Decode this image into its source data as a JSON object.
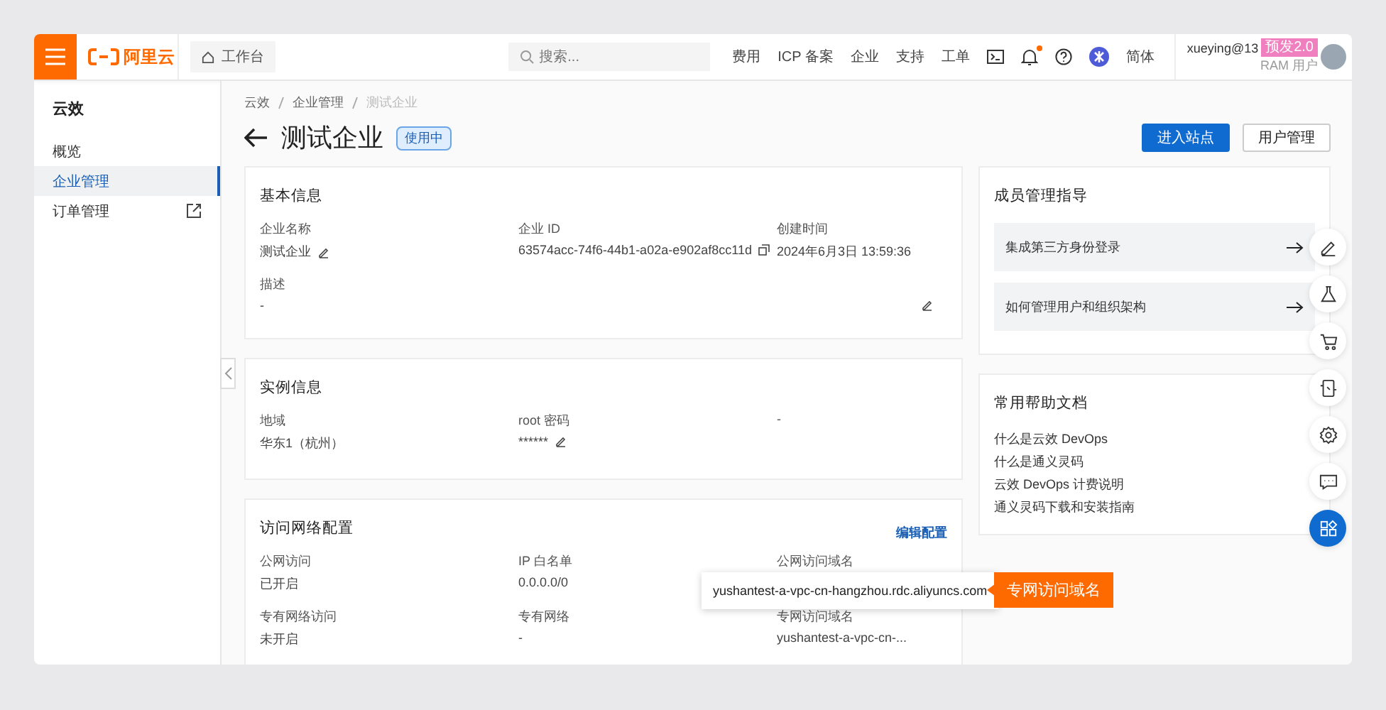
{
  "topbar": {
    "logo": "阿里云",
    "workbench": "工作台",
    "search": {
      "placeholder": "搜索..."
    },
    "nav": [
      "费用",
      "ICP 备案",
      "企业",
      "支持",
      "工单"
    ],
    "icons": [
      {
        "kind": "terminal",
        "dot": false
      },
      {
        "kind": "bell",
        "dot": true
      },
      {
        "kind": "help",
        "dot": false
      },
      {
        "kind": "app",
        "dot": false
      }
    ],
    "language": "简体",
    "user": {
      "name": "xueying@13",
      "role": "RAM 用户",
      "badge": "预发2.0"
    }
  },
  "sidebar": {
    "title": "云效",
    "items": [
      {
        "label": "概览",
        "selected": false,
        "external": false
      },
      {
        "label": "企业管理",
        "selected": true,
        "external": false
      },
      {
        "label": "订单管理",
        "selected": false,
        "external": true
      }
    ]
  },
  "breadcrumb": [
    "云效",
    "企业管理",
    "测试企业"
  ],
  "page": {
    "title": "测试企业",
    "status": "使用中",
    "buttons": [
      {
        "label": "进入站点",
        "kind": "primary"
      },
      {
        "label": "用户管理",
        "kind": "default"
      }
    ]
  },
  "cards": [
    {
      "title": "基本信息",
      "rows": [
        [
          {
            "label": "企业名称",
            "value": "测试企业",
            "editable": true,
            "copyable": false
          },
          {
            "label": "企业 ID",
            "value": "63574acc-74f6-44b1-a02a-e902af8cc11d",
            "editable": false,
            "copyable": true
          },
          {
            "label": "创建时间",
            "value": "2024年6月3日 13:59:36"
          }
        ],
        [
          {
            "label": "描述",
            "value": "-",
            "editable": true,
            "copyable": false
          }
        ]
      ]
    },
    {
      "title": "实例信息",
      "rows": [
        [
          {
            "label": "地域",
            "value": "华东1（杭州）"
          },
          {
            "label": "root 密码",
            "value": "******",
            "editable": true,
            "copyable": false
          },
          {
            "label": "-"
          }
        ]
      ]
    },
    {
      "title": "访问网络配置",
      "link": "编辑配置",
      "rows": [
        [
          {
            "label": "公网访问",
            "value": "已开启"
          },
          {
            "label": "IP 白名单",
            "value": "0.0.0.0/0"
          },
          {
            "label": "公网访问域名"
          }
        ],
        [
          {
            "label": "专有网络访问",
            "value": "未开启"
          },
          {
            "label": "专有网络",
            "value": "-"
          },
          {
            "label": "专网访问域名",
            "value": "yushantest-a-vpc-cn-..."
          }
        ]
      ],
      "tooltip": "yushantest-a-vpc-cn-hangzhou.rdc.aliyuncs.com",
      "callout": "专网访问域名"
    }
  ],
  "guide": {
    "title": "成员管理指导",
    "items": [
      "集成第三方身份登录",
      "如何管理用户和组织架构"
    ]
  },
  "docs": {
    "title": "常用帮助文档",
    "links": [
      "什么是云效 DevOps",
      "什么是通义灵码",
      "云效 DevOps 计费说明",
      "通义灵码下载和安装指南"
    ]
  },
  "float_buttons": [
    {
      "kind": "edit",
      "selected": false
    },
    {
      "kind": "flask",
      "selected": false
    },
    {
      "kind": "cart",
      "selected": false
    },
    {
      "kind": "device",
      "selected": false
    },
    {
      "kind": "settings",
      "selected": false
    },
    {
      "kind": "chat",
      "selected": false
    },
    {
      "kind": "apps",
      "selected": true
    }
  ]
}
